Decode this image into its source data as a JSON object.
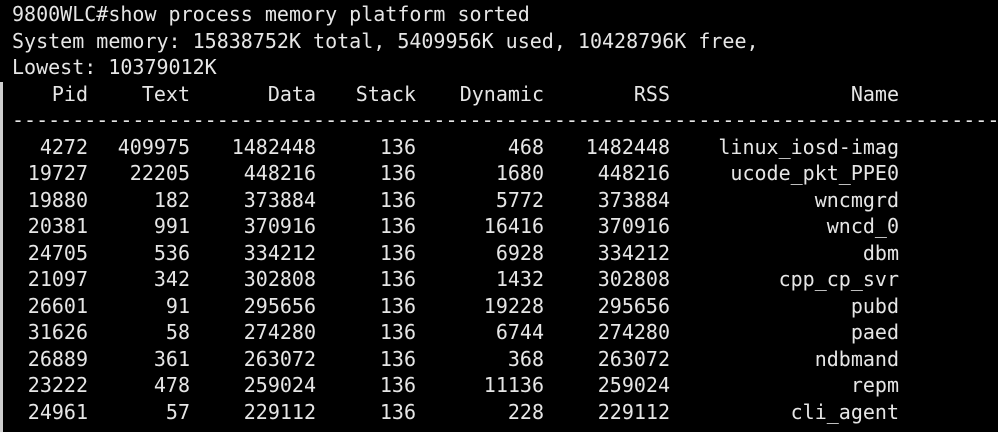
{
  "prompt_line": "9800WLC#show process memory platform sorted",
  "summary_line1": "System memory: 15838752K total, 5409956K used, 10428796K free,",
  "summary_line2": "Lowest: 10379012K",
  "headers": {
    "pid": "Pid",
    "text": "Text",
    "data": "Data",
    "stack": "Stack",
    "dynamic": "Dynamic",
    "rss": "RSS",
    "name": "Name"
  },
  "separator": "-----------------------------------------------------------------------------------------",
  "rows": [
    {
      "pid": "4272",
      "text": "409975",
      "data": "1482448",
      "stack": "136",
      "dynamic": "468",
      "rss": "1482448",
      "name": "linux_iosd-imag"
    },
    {
      "pid": "19727",
      "text": "22205",
      "data": "448216",
      "stack": "136",
      "dynamic": "1680",
      "rss": "448216",
      "name": "ucode_pkt_PPE0"
    },
    {
      "pid": "19880",
      "text": "182",
      "data": "373884",
      "stack": "136",
      "dynamic": "5772",
      "rss": "373884",
      "name": "wncmgrd"
    },
    {
      "pid": "20381",
      "text": "991",
      "data": "370916",
      "stack": "136",
      "dynamic": "16416",
      "rss": "370916",
      "name": "wncd_0"
    },
    {
      "pid": "24705",
      "text": "536",
      "data": "334212",
      "stack": "136",
      "dynamic": "6928",
      "rss": "334212",
      "name": "dbm"
    },
    {
      "pid": "21097",
      "text": "342",
      "data": "302808",
      "stack": "136",
      "dynamic": "1432",
      "rss": "302808",
      "name": "cpp_cp_svr"
    },
    {
      "pid": "26601",
      "text": "91",
      "data": "295656",
      "stack": "136",
      "dynamic": "19228",
      "rss": "295656",
      "name": "pubd"
    },
    {
      "pid": "31626",
      "text": "58",
      "data": "274280",
      "stack": "136",
      "dynamic": "6744",
      "rss": "274280",
      "name": "paed"
    },
    {
      "pid": "26889",
      "text": "361",
      "data": "263072",
      "stack": "136",
      "dynamic": "368",
      "rss": "263072",
      "name": "ndbmand"
    },
    {
      "pid": "23222",
      "text": "478",
      "data": "259024",
      "stack": "136",
      "dynamic": "11136",
      "rss": "259024",
      "name": "repm"
    },
    {
      "pid": "24961",
      "text": "57",
      "data": "229112",
      "stack": "136",
      "dynamic": "228",
      "rss": "229112",
      "name": "cli_agent"
    }
  ]
}
